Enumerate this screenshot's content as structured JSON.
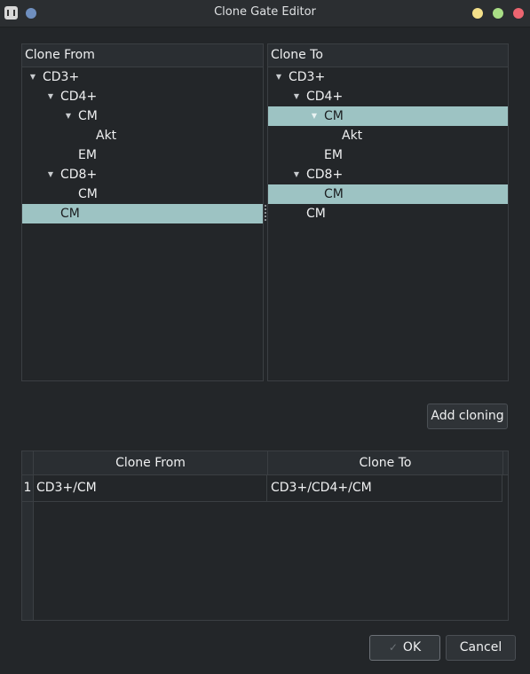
{
  "window": {
    "title": "Clone Gate Editor"
  },
  "clone_from": {
    "header": "Clone From",
    "rows": [
      {
        "label": "CD3+",
        "depth": 0,
        "expanded": true,
        "selected": false
      },
      {
        "label": "CD4+",
        "depth": 1,
        "expanded": true,
        "selected": false
      },
      {
        "label": "CM",
        "depth": 2,
        "expanded": true,
        "selected": false
      },
      {
        "label": "Akt",
        "depth": 3,
        "expanded": false,
        "selected": false
      },
      {
        "label": "EM",
        "depth": 2,
        "expanded": false,
        "selected": false
      },
      {
        "label": "CD8+",
        "depth": 1,
        "expanded": true,
        "selected": false
      },
      {
        "label": "CM",
        "depth": 2,
        "expanded": false,
        "selected": false
      },
      {
        "label": "CM",
        "depth": 1,
        "expanded": false,
        "selected": true
      }
    ]
  },
  "clone_to": {
    "header": "Clone To",
    "rows": [
      {
        "label": "CD3+",
        "depth": 0,
        "expanded": true,
        "selected": false
      },
      {
        "label": "CD4+",
        "depth": 1,
        "expanded": true,
        "selected": false
      },
      {
        "label": "CM",
        "depth": 2,
        "expanded": true,
        "selected": true
      },
      {
        "label": "Akt",
        "depth": 3,
        "expanded": false,
        "selected": false
      },
      {
        "label": "EM",
        "depth": 2,
        "expanded": false,
        "selected": false
      },
      {
        "label": "CD8+",
        "depth": 1,
        "expanded": true,
        "selected": false
      },
      {
        "label": "CM",
        "depth": 2,
        "expanded": false,
        "selected": true
      },
      {
        "label": "CM",
        "depth": 1,
        "expanded": false,
        "selected": false
      }
    ]
  },
  "add_button": "Add cloning",
  "cloning_table": {
    "columns": [
      "Clone From",
      "Clone To"
    ],
    "rows": [
      {
        "num": "1",
        "from": "CD3+/CM",
        "to": "CD3+/CD4+/CM"
      }
    ]
  },
  "buttons": {
    "ok": "OK",
    "cancel": "Cancel"
  },
  "colors": {
    "background": "#232629",
    "selection": "#9dc3c3"
  }
}
